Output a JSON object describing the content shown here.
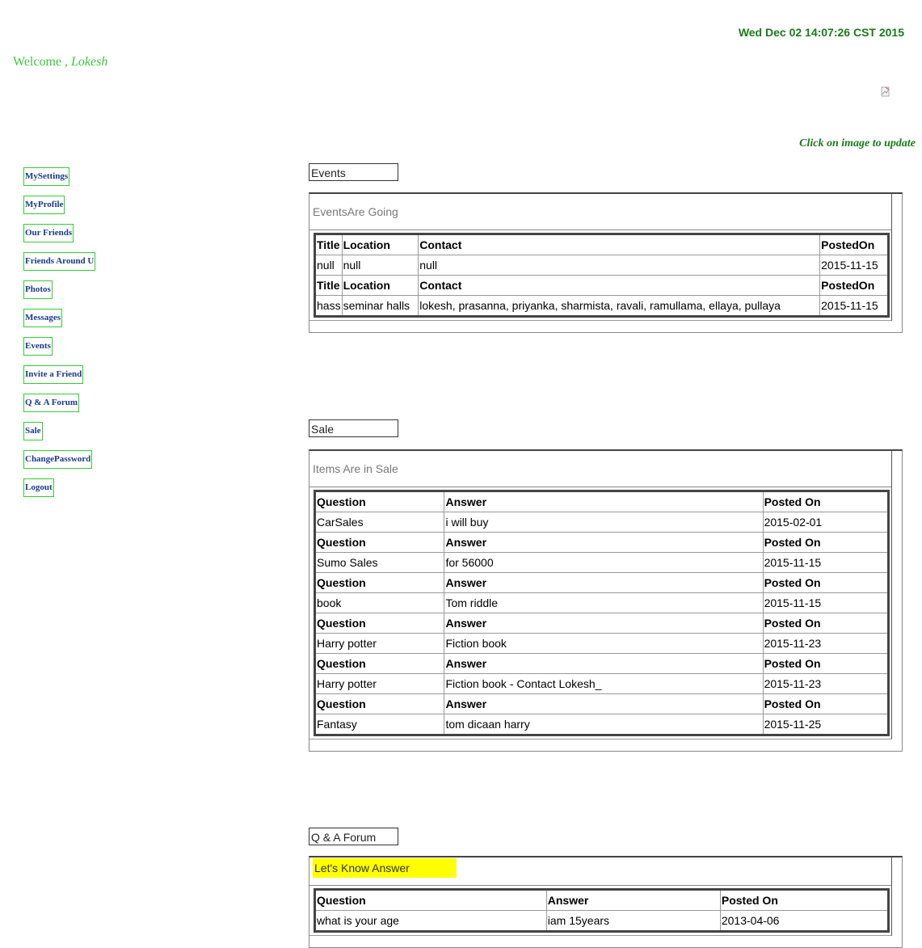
{
  "header": {
    "datetime": "Wed Dec 02 14:07:26 CST 2015",
    "welcome_prefix": "Welcome , ",
    "welcome_name": "Lokesh",
    "click_hint": "Click on image to update"
  },
  "nav": {
    "items": [
      "MySettings",
      "MyProfile",
      "Our Friends",
      "Friends Around U",
      "Photos",
      "Messages",
      "Events",
      "Invite a Friend",
      "Q & A Forum",
      "Sale",
      "ChangePassword",
      "Logout"
    ]
  },
  "events": {
    "label": "Events",
    "caption": "EventsAre Going",
    "headers": [
      "Title",
      "Location",
      "Contact",
      "PostedOn"
    ],
    "rows": [
      [
        "null",
        "null",
        "null",
        "2015-11-15"
      ],
      [
        "hass",
        "seminar halls",
        "lokesh, prasanna, priyanka, sharmista, ravali, ramullama, ellaya, pullaya",
        "2015-11-15"
      ]
    ]
  },
  "sale": {
    "label": "Sale",
    "caption": "Items Are in Sale",
    "headers": [
      "Question",
      "Answer",
      "Posted On"
    ],
    "rows": [
      [
        "CarSales",
        "i will buy",
        "2015-02-01"
      ],
      [
        "Sumo Sales",
        "for 56000",
        "2015-11-15"
      ],
      [
        "book",
        "Tom riddle",
        "2015-11-15"
      ],
      [
        "Harry potter",
        "Fiction book",
        "2015-11-23"
      ],
      [
        "Harry potter",
        "Fiction book - Contact Lokesh_",
        "2015-11-23"
      ],
      [
        "Fantasy",
        "tom dicaan harry",
        "2015-11-25"
      ]
    ]
  },
  "forum": {
    "label": "Q & A Forum",
    "caption": "Let's Know Answer",
    "headers": [
      "Question",
      "Answer",
      "Posted On"
    ],
    "rows": [
      [
        "what is your age",
        "iam 15years",
        "2013-04-06"
      ]
    ]
  },
  "colors": {
    "accent_green": "#1a7a1a",
    "nav_border": "#33cc33",
    "nav_text": "#1a3a8a",
    "highlight": "#ffff00"
  },
  "icons": {
    "profile_image": "broken-image-icon"
  }
}
